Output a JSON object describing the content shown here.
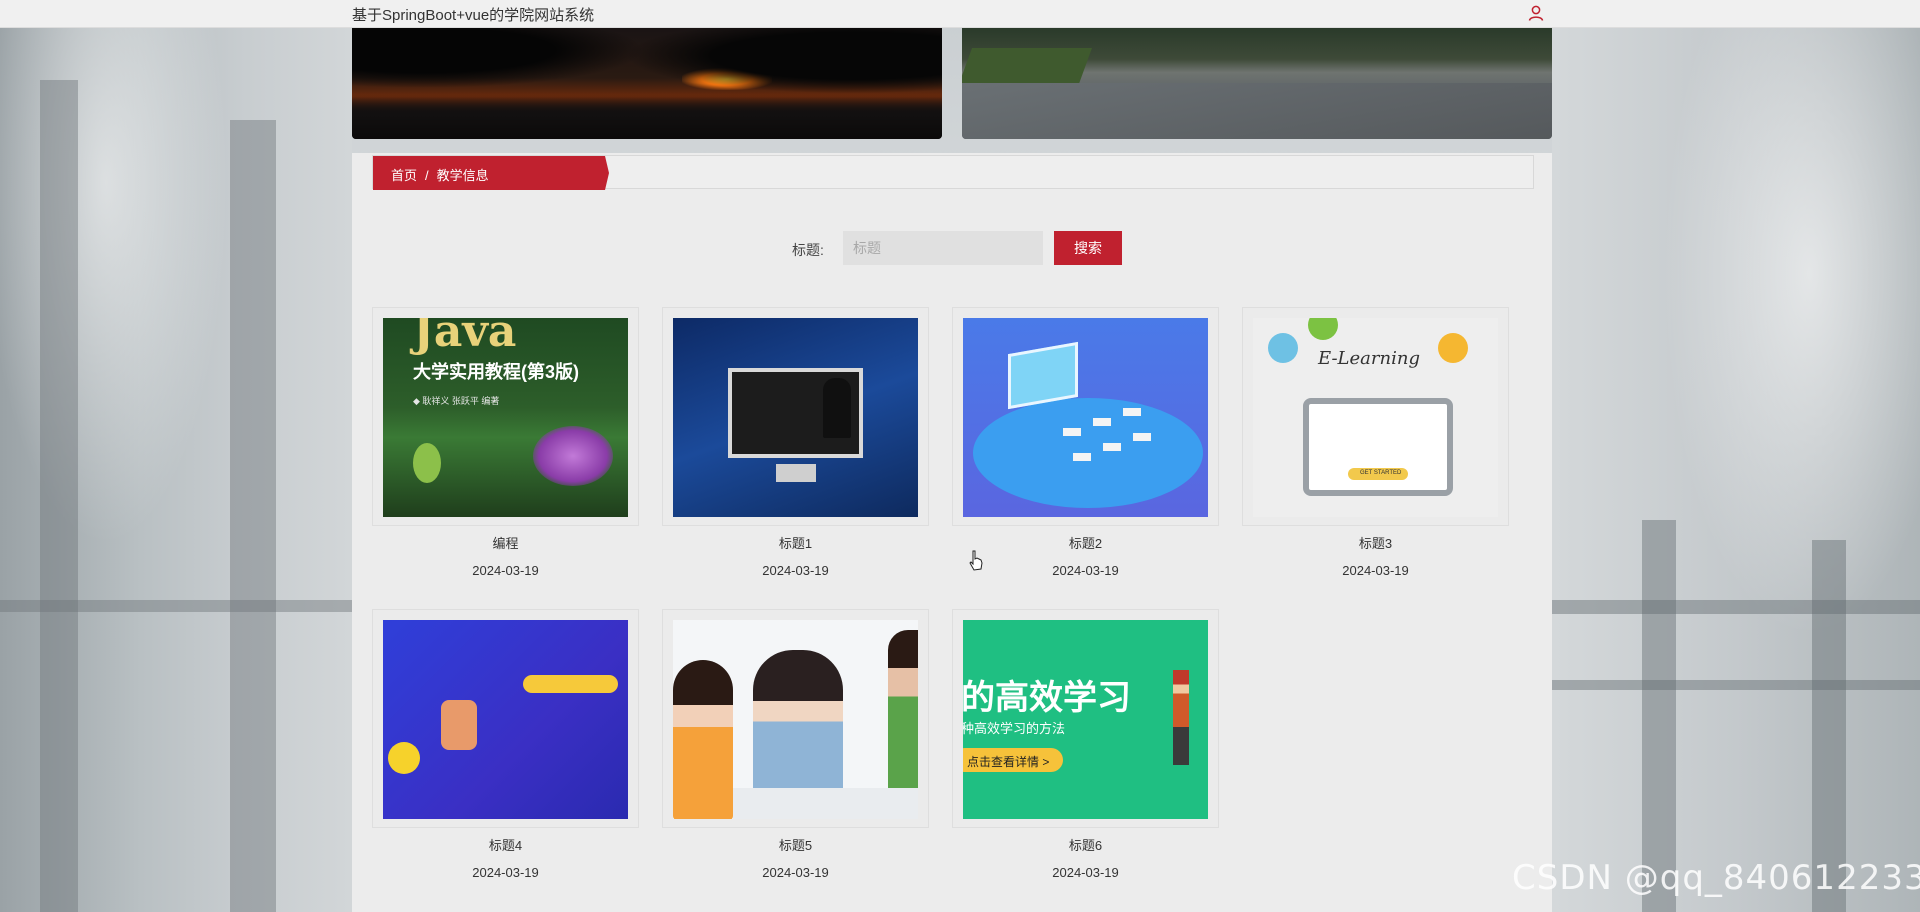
{
  "header": {
    "site_title": "基于SpringBoot+vue的学院网站系统",
    "user_icon": "user-icon"
  },
  "breadcrumb": {
    "home": "首页",
    "separator": "/",
    "current": "教学信息"
  },
  "search": {
    "label": "标题:",
    "placeholder": "标题",
    "button_label": "搜索"
  },
  "cards": [
    {
      "title": "编程",
      "date": "2024-03-19",
      "image_text_1": "Java",
      "image_text_2": "大学实用教程(第3版)",
      "image_text_3": "◆ 耿祥义  张跃平  编著"
    },
    {
      "title": "标题1",
      "date": "2024-03-19"
    },
    {
      "title": "标题2",
      "date": "2024-03-19"
    },
    {
      "title": "标题3",
      "date": "2024-03-19",
      "image_text_1": "E-Learning",
      "image_text_2": "GET STARTED"
    },
    {
      "title": "标题4",
      "date": "2024-03-19"
    },
    {
      "title": "标题5",
      "date": "2024-03-19"
    },
    {
      "title": "标题6",
      "date": "2024-03-19",
      "image_text_1": "的高效学习",
      "image_text_2": "种高效学习的方法",
      "image_text_3": "点击查看详情 >"
    }
  ],
  "watermark": "CSDN @qq_840612233",
  "colors": {
    "accent": "#c0212f",
    "topbar": "#f0f0f0",
    "panel": "#ececec"
  }
}
